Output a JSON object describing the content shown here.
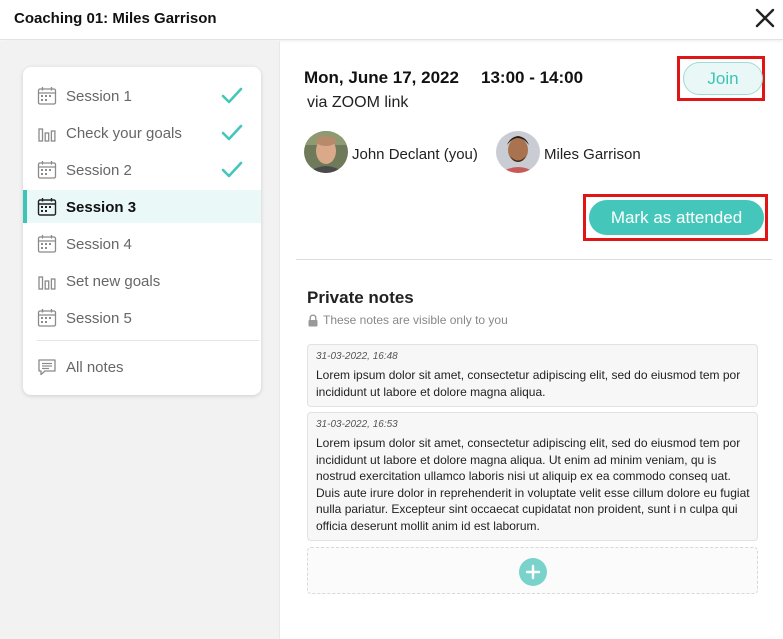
{
  "window": {
    "title": "Coaching 01: Miles Garrison"
  },
  "sidebar": {
    "items": [
      {
        "label": "Session 1",
        "icon": "calendar-icon",
        "completed": true
      },
      {
        "label": "Check your goals",
        "icon": "bar-chart-icon",
        "completed": true
      },
      {
        "label": "Session 2",
        "icon": "calendar-icon",
        "completed": true
      },
      {
        "label": "Session 3",
        "icon": "calendar-icon",
        "completed": false,
        "active": true
      },
      {
        "label": "Session 4",
        "icon": "calendar-icon",
        "completed": false
      },
      {
        "label": "Set new goals",
        "icon": "bar-chart-icon",
        "completed": false
      },
      {
        "label": "Session 5",
        "icon": "calendar-icon",
        "completed": false
      }
    ],
    "all_notes": {
      "label": "All notes",
      "icon": "notes-icon"
    }
  },
  "session": {
    "date": "Mon, June 17, 2022",
    "time": "13:00 - 14:00",
    "via": "via ZOOM link",
    "join_label": "Join",
    "participants": [
      {
        "name": "John Declant (you)"
      },
      {
        "name": "Miles Garrison"
      }
    ],
    "mark_attended_label": "Mark as attended"
  },
  "notes": {
    "title": "Private notes",
    "subtitle": "These notes are visible only to you",
    "items": [
      {
        "timestamp": "31-03-2022, 16:48",
        "text": "Lorem ipsum dolor sit amet, consectetur adipiscing elit, sed do eiusmod tem por incididunt ut labore et dolore magna aliqua."
      },
      {
        "timestamp": "31-03-2022, 16:53",
        "text": "Lorem ipsum dolor sit amet, consectetur adipiscing elit, sed do eiusmod tem por incididunt ut labore et dolore magna aliqua. Ut enim ad minim veniam, qu is nostrud exercitation ullamco laboris nisi ut aliquip ex ea commodo conseq uat. Duis aute irure dolor in reprehenderit in voluptate velit esse cillum dolore eu fugiat nulla pariatur. Excepteur sint occaecat cupidatat non proident, sunt i n culpa qui officia deserunt mollit anim id est laborum."
      }
    ],
    "add_icon": "plus-icon"
  },
  "colors": {
    "accent": "#44c7ba",
    "accent_light": "#e9f8f6",
    "highlight_border": "#e01515",
    "sidebar_bg": "#f2f2f2"
  }
}
